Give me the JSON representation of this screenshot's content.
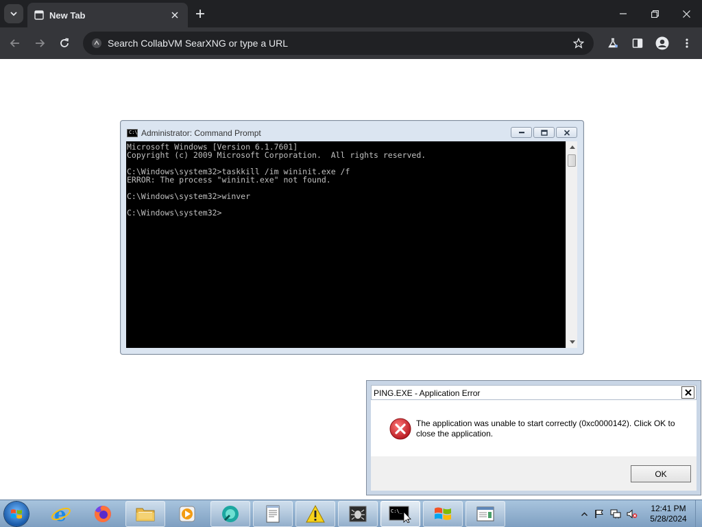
{
  "browser": {
    "tab_title": "New Tab",
    "address_placeholder": "Search CollabVM SearXNG or type a URL"
  },
  "cmd": {
    "title": "Administrator: Command Prompt",
    "icon_text": "C:\\",
    "lines": [
      "Microsoft Windows [Version 6.1.7601]",
      "Copyright (c) 2009 Microsoft Corporation.  All rights reserved.",
      "",
      "C:\\Windows\\system32>taskkill /im wininit.exe /f",
      "ERROR: The process \"wininit.exe\" not found.",
      "",
      "C:\\Windows\\system32>winver",
      "",
      "C:\\Windows\\system32>"
    ]
  },
  "error_dialog": {
    "title": "PING.EXE - Application Error",
    "message": "The application was unable to start correctly (0xc0000142). Click OK to close the application.",
    "ok_label": "OK"
  },
  "taskbar": {
    "apps": [
      {
        "name": "ie-icon",
        "state": "normal"
      },
      {
        "name": "firefox-icon",
        "state": "normal"
      },
      {
        "name": "explorer-folder-icon",
        "state": "pinned"
      },
      {
        "name": "media-player-icon",
        "state": "normal"
      },
      {
        "name": "teal-app-icon",
        "state": "pinned"
      },
      {
        "name": "notepad-icon",
        "state": "pinned"
      },
      {
        "name": "warning-app-icon",
        "state": "pinned"
      },
      {
        "name": "bug-app-icon",
        "state": "pinned"
      },
      {
        "name": "cmd-taskbar-icon",
        "state": "active"
      },
      {
        "name": "windows-flag-app-icon",
        "state": "pinned"
      },
      {
        "name": "window-app-icon",
        "state": "pinned"
      }
    ],
    "time": "12:41 PM",
    "date": "5/28/2024"
  },
  "colors": {
    "chrome_dark": "#202124",
    "chrome_toolbar": "#35363a",
    "console_text": "#c0c0c0",
    "error_red": "#d9262c"
  }
}
